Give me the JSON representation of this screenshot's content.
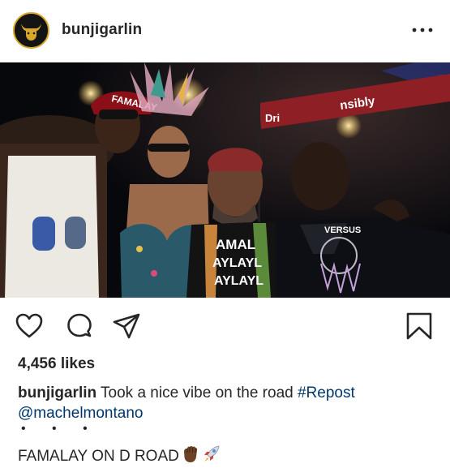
{
  "post": {
    "username": "bunjigarlin",
    "more_icon": "more-horizontal-icon",
    "photo": {
      "subject": "four-people-at-carnival-night-photo",
      "cap_text": "FAMALAY",
      "shirt_text": "AMALAYLAYLAYLAYLAYLAYLAY",
      "banner_text_left": "Dri",
      "banner_text_right": "nsibly",
      "shirt2_text": "VERSUS"
    },
    "actions": {
      "like_icon": "heart-icon",
      "comment_icon": "comment-icon",
      "share_icon": "paper-plane-icon",
      "save_icon": "bookmark-icon"
    },
    "likes": "4,456 likes",
    "caption": {
      "user": "bunjigarlin",
      "text": " Took a nice vibe on the road ",
      "hashtag": "#Repost",
      "mention": "@machelmontano",
      "dots": "• • •",
      "line2": "FAMALAY ON D ROAD",
      "emoji_icons": [
        "raised-fist-icon",
        "rocket-icon"
      ]
    },
    "colors": {
      "text": "#262626",
      "link": "#00376b",
      "avatar_ring": "#d9a72a"
    }
  }
}
